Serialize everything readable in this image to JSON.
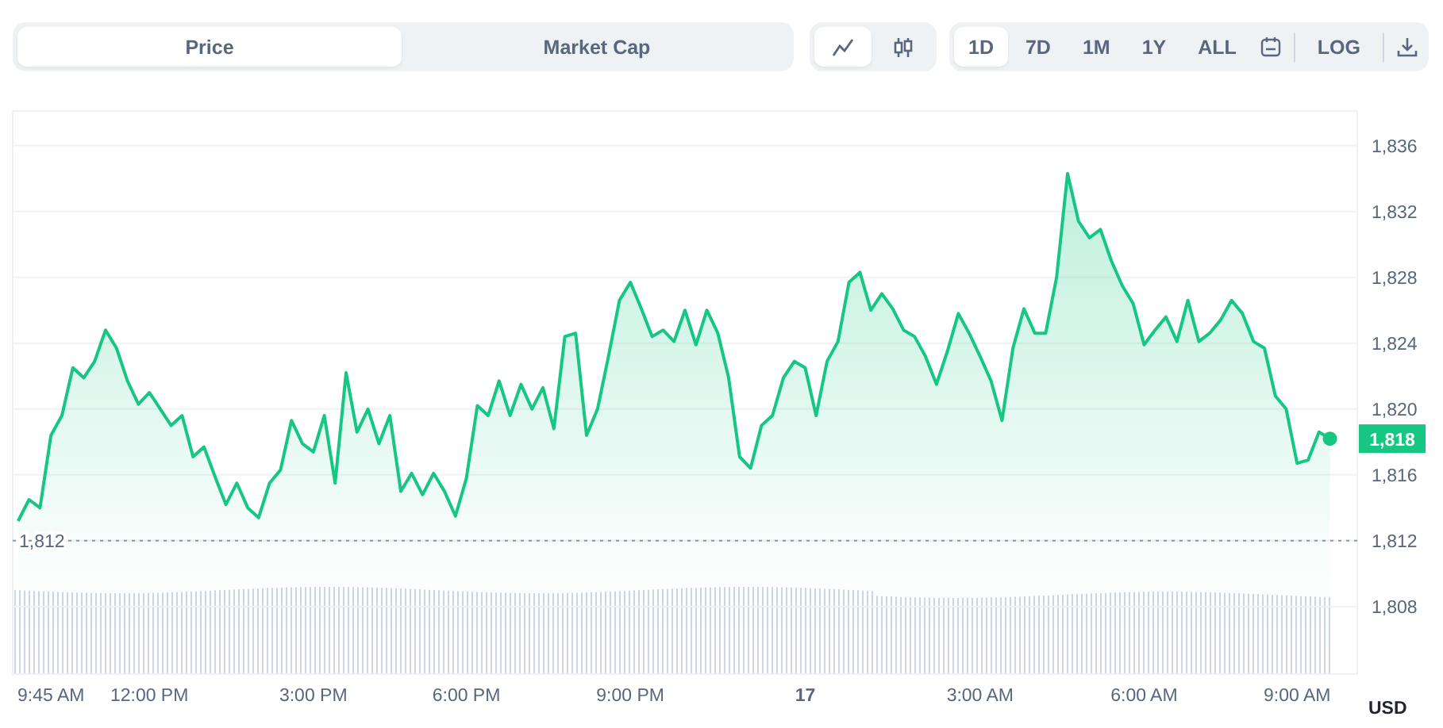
{
  "chart_tabs": [
    {
      "label": "Price",
      "selected": true
    },
    {
      "label": "Market Cap",
      "selected": false
    }
  ],
  "chart_types": [
    {
      "kind": "line",
      "selected": true
    },
    {
      "kind": "candles",
      "selected": false
    }
  ],
  "ranges": [
    {
      "label": "1D",
      "selected": true
    },
    {
      "label": "7D",
      "selected": false
    },
    {
      "label": "1M",
      "selected": false
    },
    {
      "label": "1Y",
      "selected": false
    },
    {
      "label": "ALL",
      "selected": false
    }
  ],
  "log_button": {
    "label": "LOG"
  },
  "chart": {
    "chart_data": {
      "type": "area",
      "ylabel": "USD",
      "ylim": [
        1803.9,
        1838.1
      ],
      "yticks": [
        {
          "value": 1808,
          "label": "1,808"
        },
        {
          "value": 1812,
          "label": "1,812"
        },
        {
          "value": 1816,
          "label": "1,816"
        },
        {
          "value": 1820,
          "label": "1,820"
        },
        {
          "value": 1824,
          "label": "1,824"
        },
        {
          "value": 1828,
          "label": "1,828"
        },
        {
          "value": 1832,
          "label": "1,832"
        },
        {
          "value": 1836,
          "label": "1,836"
        }
      ],
      "categories": [
        null,
        null,
        null,
        "9:45 AM",
        null,
        null,
        null,
        null,
        null,
        null,
        null,
        null,
        "12:00 PM",
        null,
        null,
        null,
        null,
        null,
        null,
        null,
        null,
        null,
        null,
        null,
        null,
        null,
        null,
        "3:00 PM",
        null,
        null,
        null,
        null,
        null,
        null,
        null,
        null,
        null,
        null,
        null,
        null,
        null,
        "6:00 PM",
        null,
        null,
        null,
        null,
        null,
        null,
        null,
        null,
        null,
        null,
        null,
        null,
        null,
        null,
        "9:00 PM",
        null,
        null,
        null,
        null,
        null,
        null,
        null,
        null,
        null,
        null,
        null,
        null,
        null,
        null,
        null,
        "17",
        null,
        null,
        null,
        null,
        null,
        null,
        null,
        null,
        null,
        null,
        null,
        null,
        null,
        null,
        null,
        "3:00 AM",
        null,
        null,
        null,
        null,
        null,
        null,
        null,
        null,
        null,
        null,
        null,
        null,
        null,
        null,
        "6:00 AM",
        null,
        null,
        null,
        null,
        null,
        null,
        null,
        null,
        null,
        null,
        null,
        null,
        null,
        "9:00 AM",
        null,
        null,
        null,
        null,
        null
      ],
      "series": [
        {
          "color": "#16c784",
          "values": [
            1813.2,
            1814.5,
            1814,
            1818.4,
            1819.6,
            1822.5,
            1821.9,
            1822.9,
            1824.8,
            1823.7,
            1821.7,
            1820.3,
            1821,
            1820,
            1819,
            1819.6,
            1817.1,
            1817.7,
            1815.9,
            1814.2,
            1815.5,
            1814,
            1813.4,
            1815.5,
            1816.3,
            1819.3,
            1817.9,
            1817.4,
            1819.6,
            1815.5,
            1822.2,
            1818.6,
            1820,
            1817.9,
            1819.6,
            1815,
            1816.1,
            1814.8,
            1816.1,
            1815,
            1813.5,
            1815.8,
            1820.2,
            1819.6,
            1821.7,
            1819.6,
            1821.5,
            1820,
            1821.3,
            1818.8,
            1824.4,
            1824.6,
            1818.4,
            1820,
            1823.2,
            1826.6,
            1827.7,
            1826.1,
            1824.4,
            1824.8,
            1824.1,
            1826,
            1823.9,
            1826,
            1824.6,
            1821.9,
            1817.1,
            1816.4,
            1819,
            1819.6,
            1821.9,
            1822.9,
            1822.5,
            1819.6,
            1822.9,
            1824.1,
            1827.7,
            1828.3,
            1826,
            1827,
            1826.1,
            1824.8,
            1824.4,
            1823.2,
            1821.5,
            1823.5,
            1825.8,
            1824.6,
            1823.2,
            1821.7,
            1819.3,
            1823.7,
            1826.1,
            1824.6,
            1824.6,
            1828,
            1834.3,
            1831.4,
            1830.4,
            1830.9,
            1829,
            1827.5,
            1826.4,
            1823.9,
            1824.8,
            1825.6,
            1824.1,
            1826.6,
            1824.1,
            1824.6,
            1825.4,
            1826.6,
            1825.8,
            1824.1,
            1823.7,
            1820.8,
            1820,
            1816.7,
            1816.9,
            1818.6,
            1818.2,
            null,
            null
          ]
        }
      ],
      "grid": true,
      "ref_lines": [
        {
          "axis": "y",
          "value": 1812,
          "label": "1,812"
        }
      ]
    },
    "last_price_badge": "1,818"
  }
}
